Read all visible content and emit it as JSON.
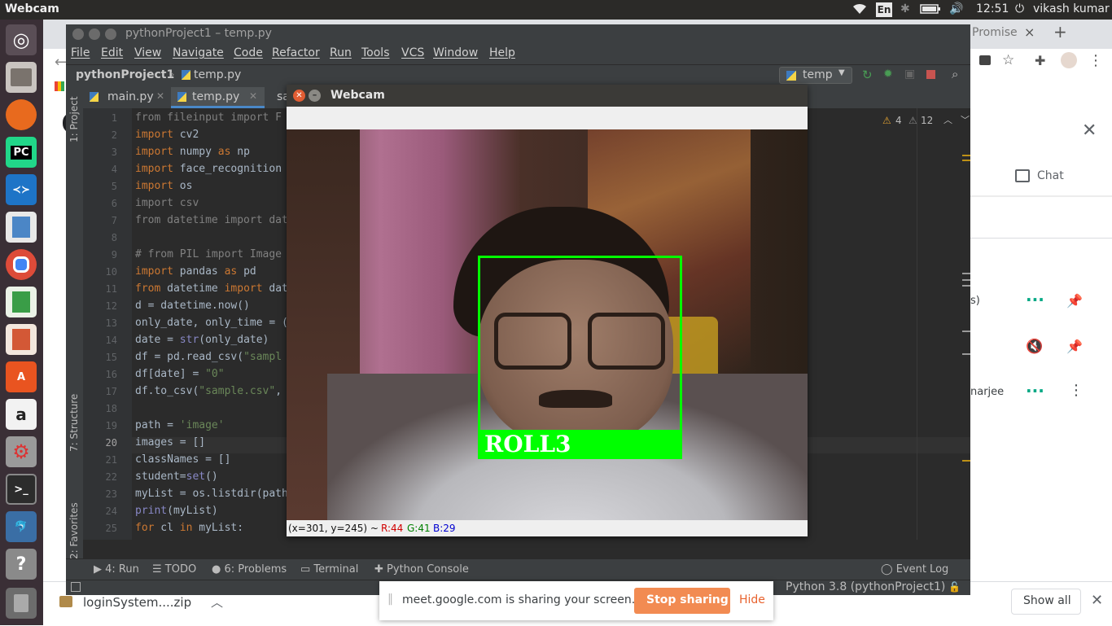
{
  "topbar": {
    "app_name": "Webcam",
    "lang": "En",
    "time": "12:51",
    "user": "vikash kumar"
  },
  "chrome": {
    "tab_partial": "Promise",
    "tab_close": "×",
    "new_tab": "+",
    "chat_label": "Chat",
    "participant_1_partial": "s)",
    "participant_2_partial": "narjee",
    "download_file": "loginSystem....zip",
    "show_all": "Show all",
    "share_text": "meet.google.com is sharing your screen.",
    "stop_sharing": "Stop sharing",
    "hide": "Hide"
  },
  "pycharm": {
    "title": "pythonProject1 – temp.py",
    "menu": [
      "File",
      "Edit",
      "View",
      "Navigate",
      "Code",
      "Refactor",
      "Run",
      "Tools",
      "VCS",
      "Window",
      "Help"
    ],
    "breadcrumb_project": "pythonProject1",
    "breadcrumb_file": "temp.py",
    "run_config": "temp",
    "tabs": [
      "main.py",
      "temp.py",
      "sa"
    ],
    "warnings": "4",
    "weak_warnings": "12",
    "side_project": "1: Project",
    "side_structure": "7: Structure",
    "side_favorites": "2: Favorites",
    "line_numbers": [
      "1",
      "2",
      "3",
      "4",
      "5",
      "6",
      "7",
      "8",
      "9",
      "10",
      "11",
      "12",
      "13",
      "14",
      "15",
      "16",
      "17",
      "18",
      "19",
      "20",
      "21",
      "22",
      "23",
      "24",
      "25"
    ],
    "code": {
      "l1": "from fileinput import F",
      "l2_kw": "import",
      "l2": " cv2",
      "l3_kw": "import",
      "l3": " numpy ",
      "l3_as": "as",
      "l3b": " np",
      "l4_kw": "import",
      "l4": " face_recognition",
      "l5_kw": "import",
      "l5": " os",
      "l6": "import csv",
      "l7": "from datetime import dat",
      "l9": "# from PIL import Image",
      "l10_kw": "import",
      "l10": " pandas ",
      "l10_as": "as",
      "l10b": " pd",
      "l11_kw": "from",
      "l11": " datetime ",
      "l11_kw2": "import",
      "l11b": " dat",
      "l12": "d = datetime.now()",
      "l13": "only_date, only_time = (",
      "l14a": "date = ",
      "l14_fn": "str",
      "l14b": "(only_date)",
      "l15a": "df = pd.read_csv(",
      "l15_str": "\"sampl",
      "l16a": "df[date] = ",
      "l16_str": "\"0\"",
      "l17a": "df.to_csv(",
      "l17_str": "\"sample.csv\"",
      "l17b": ",",
      "l19a": "path = ",
      "l19_str": "'image'",
      "l20": "images = []",
      "l21": "classNames = []",
      "l22a": "student=",
      "l22_fn": "set",
      "l22b": "()",
      "l23": "myList = os.listdir(path",
      "l24_fn": "print",
      "l24": "(myList)",
      "l25_kw": "for",
      "l25": " cl ",
      "l25_in": "in",
      "l25b": " myList:"
    },
    "tool_run": "4: Run",
    "tool_todo": "TODO",
    "tool_problems": "6: Problems",
    "tool_terminal": "Terminal",
    "tool_console": "Python Console",
    "tool_eventlog": "Event Log",
    "interpreter": "Python 3.8 (pythonProject1)"
  },
  "webcam": {
    "title": "Webcam",
    "label": "ROLL3",
    "coords": "(x=301, y=245) ~",
    "r": "R:44",
    "g": "G:41",
    "b": "B:29"
  },
  "colors": {
    "face_box": "#00ff00",
    "stop_sharing_bg": "#f28b52",
    "pycharm_keyword": "#cc7832",
    "pycharm_string": "#6a8759"
  }
}
